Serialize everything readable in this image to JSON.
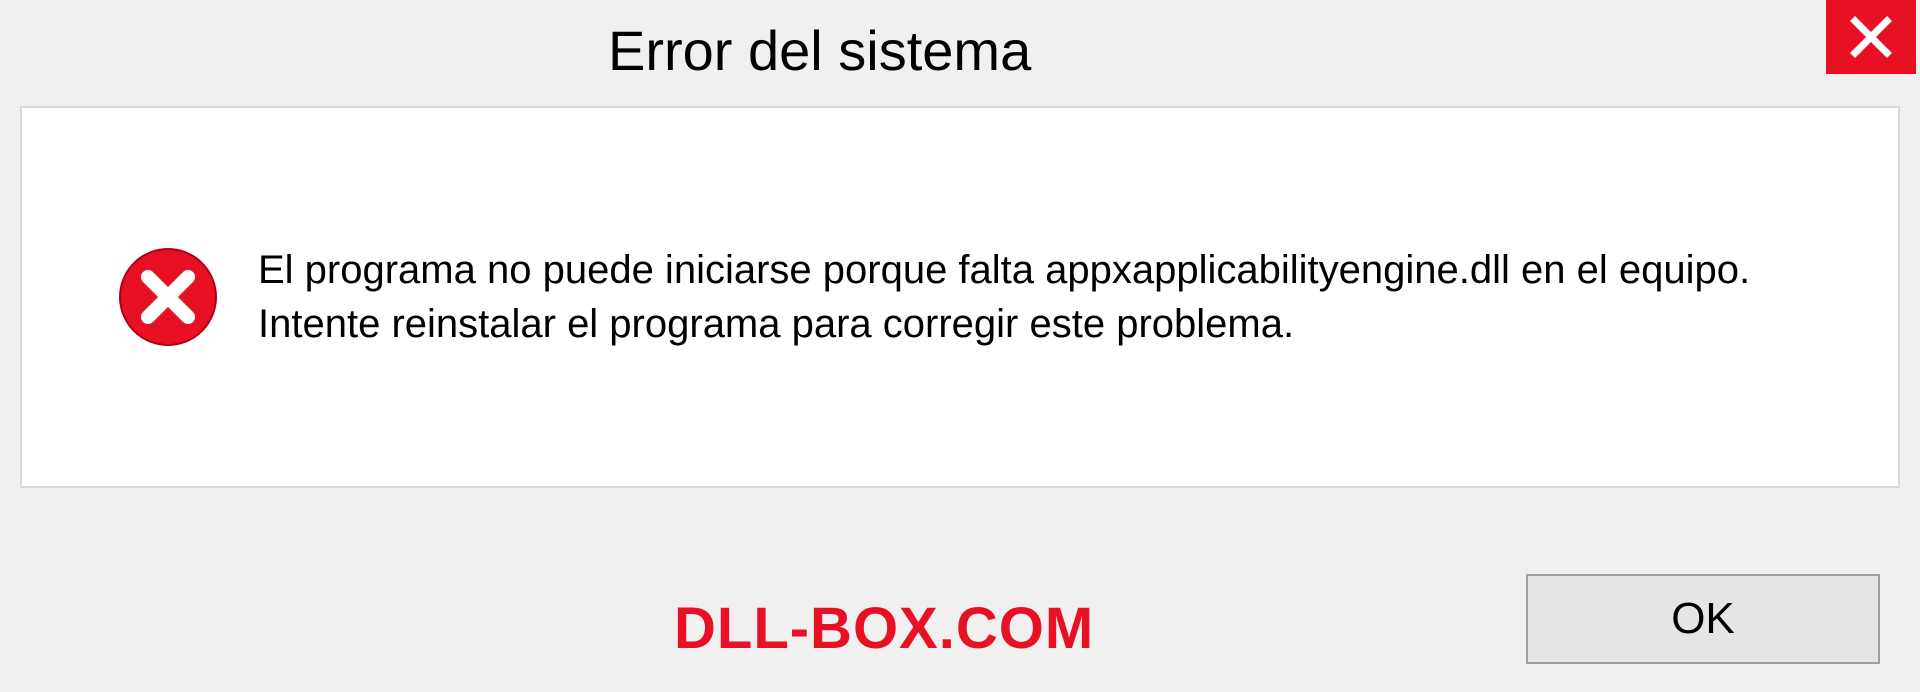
{
  "dialog": {
    "title": "Error del sistema",
    "message": "El programa no puede iniciarse porque falta appxapplicabilityengine.dll en el equipo. Intente reinstalar el programa para corregir este problema.",
    "ok_label": "OK"
  },
  "watermark": "DLL-BOX.COM",
  "colors": {
    "error_red": "#e81123",
    "panel_bg": "#ffffff",
    "page_bg": "#f0f0f0"
  },
  "icons": {
    "close": "close-icon",
    "error": "error-circle-x-icon"
  }
}
